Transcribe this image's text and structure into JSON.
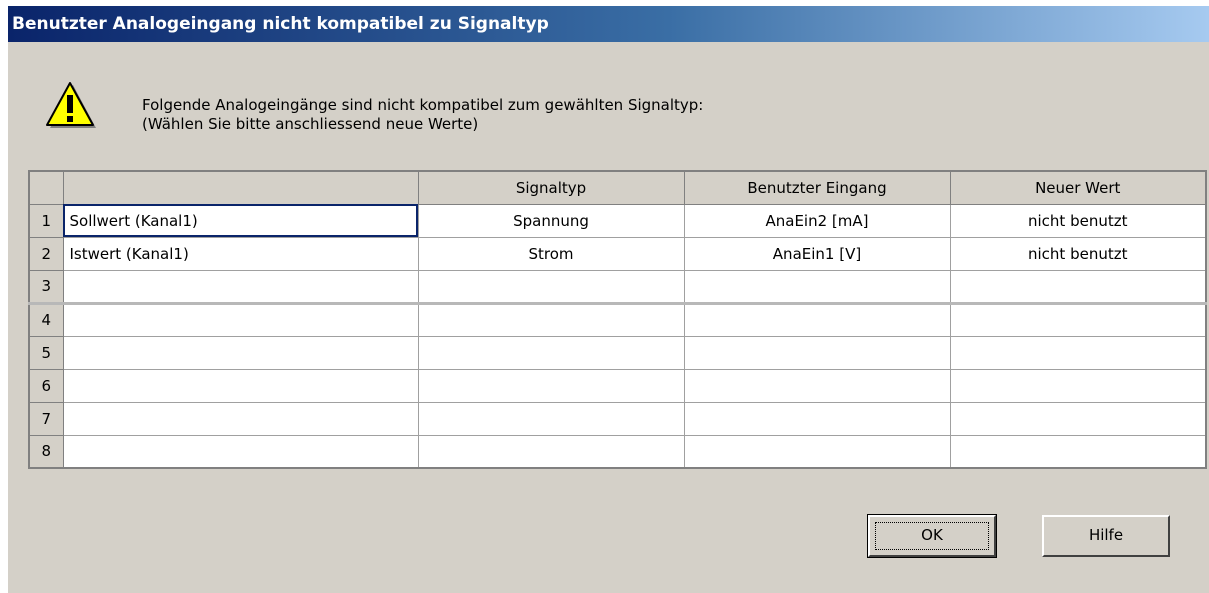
{
  "dialog": {
    "title": "Benutzter Analogeingang nicht kompatibel zu Signaltyp",
    "message_line1": "Folgende Analogeingänge sind nicht kompatibel zum gewählten Signaltyp:",
    "message_line2": "(Wählen Sie bitte anschliessend neue Werte)"
  },
  "table": {
    "headers": [
      "",
      "Signaltyp",
      "Benutzter Eingang",
      "Neuer Wert"
    ],
    "rows": [
      {
        "num": "1",
        "name": "Sollwert (Kanal1)",
        "signaltyp": "Spannung",
        "eingang": "AnaEin2 [mA]",
        "neuer_wert": "nicht benutzt"
      },
      {
        "num": "2",
        "name": "Istwert (Kanal1)",
        "signaltyp": "Strom",
        "eingang": "AnaEin1 [V]",
        "neuer_wert": "nicht benutzt"
      },
      {
        "num": "3",
        "name": "",
        "signaltyp": "",
        "eingang": "",
        "neuer_wert": ""
      },
      {
        "num": "4",
        "name": "",
        "signaltyp": "",
        "eingang": "",
        "neuer_wert": ""
      },
      {
        "num": "5",
        "name": "",
        "signaltyp": "",
        "eingang": "",
        "neuer_wert": ""
      },
      {
        "num": "6",
        "name": "",
        "signaltyp": "",
        "eingang": "",
        "neuer_wert": ""
      },
      {
        "num": "7",
        "name": "",
        "signaltyp": "",
        "eingang": "",
        "neuer_wert": ""
      },
      {
        "num": "8",
        "name": "",
        "signaltyp": "",
        "eingang": "",
        "neuer_wert": ""
      }
    ]
  },
  "buttons": {
    "ok_label": "OK",
    "help_label": "Hilfe"
  },
  "icons": {
    "warning": "warning-icon"
  },
  "colors": {
    "title_start": "#0a246a",
    "title_end": "#a6caf0",
    "face": "#d4d0c8",
    "warning_fill": "#ffff00"
  }
}
